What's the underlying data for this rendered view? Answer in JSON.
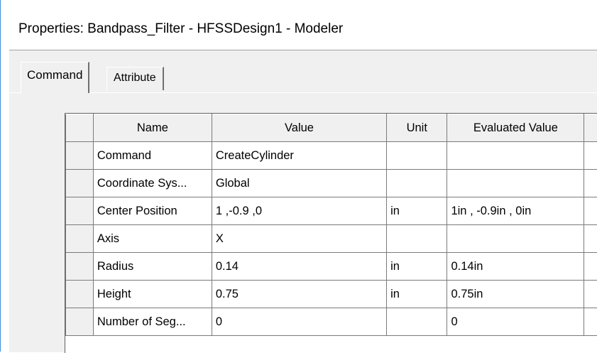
{
  "window": {
    "title": "Properties: Bandpass_Filter - HFSSDesign1 - Modeler"
  },
  "tabs": [
    {
      "label": "Command",
      "active": true
    },
    {
      "label": "Attribute",
      "active": false
    }
  ],
  "grid": {
    "columns": [
      "Name",
      "Value",
      "Unit",
      "Evaluated Value"
    ],
    "rows": [
      {
        "name": "Command",
        "value": "CreateCylinder",
        "unit": "",
        "evaluated": ""
      },
      {
        "name": "Coordinate Sys...",
        "value": "Global",
        "unit": "",
        "evaluated": ""
      },
      {
        "name": "Center Position",
        "value": "1 ,-0.9 ,0",
        "unit": "in",
        "evaluated": "1in , -0.9in , 0in"
      },
      {
        "name": "Axis",
        "value": "X",
        "unit": "",
        "evaluated": ""
      },
      {
        "name": "Radius",
        "value": "0.14",
        "unit": "in",
        "evaluated": "0.14in"
      },
      {
        "name": "Height",
        "value": "0.75",
        "unit": "in",
        "evaluated": "0.75in"
      },
      {
        "name": "Number of Seg...",
        "value": "0",
        "unit": "",
        "evaluated": "0"
      }
    ]
  }
}
